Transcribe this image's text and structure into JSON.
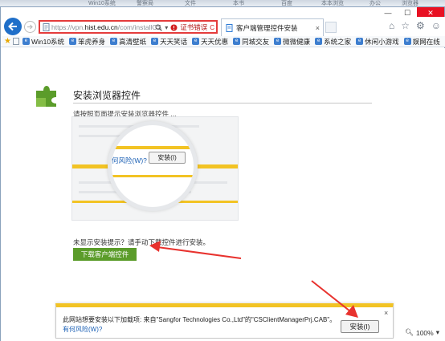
{
  "os_strip": {
    "items": [
      "Win10系统",
      "警察局",
      "文件",
      "本书",
      "百度",
      "本本浏览",
      "办公",
      "浏览器"
    ]
  },
  "window": {
    "minimize": "—",
    "maximize": "☐",
    "close": "✕"
  },
  "address_bar": {
    "url_prefix": "https://vpn.",
    "url_domain": "hist.edu.cn",
    "url_suffix": "/com/installCS",
    "cert_error": "证书错误",
    "refresh": "C"
  },
  "tab": {
    "title": "客户端管理控件安装",
    "close": "×"
  },
  "toolbar": {
    "home_icon": "⌂",
    "star_icon": "☆",
    "gear_icon": "⚙",
    "smile_icon": "☺"
  },
  "favorites": [
    "Win10系统",
    "笨虎养身",
    "高清壁纸",
    "天天笑话",
    "天天优惠",
    "同城交友",
    "微微健康",
    "系统之家",
    "休闲小游戏",
    "娱网在线"
  ],
  "page": {
    "title": "安装浏览器控件",
    "subtitle": "请按照页面提示安装浏览器控件 ...",
    "illustration": {
      "risk_link": "何风险(W)?",
      "install_button": "安装(I)"
    },
    "hint": "未显示安装提示？请手动下载控件进行安装。",
    "download_button": "下载客户端控件"
  },
  "notification": {
    "message": "此网站想要安装以下加载项: 来自\"Sangfor Technologies Co.,Ltd\"的\"CSClientManagerPrj.CAB\"。",
    "risk_link": "有何风险(W)?",
    "install_button": "安装(I)",
    "close": "×"
  },
  "status": {
    "zoom": "100%"
  },
  "colors": {
    "accent_green": "#5b9c2a",
    "warning_yellow": "#f2c324",
    "address_error": "#e43c3c",
    "arrow_red": "#e8322e"
  }
}
